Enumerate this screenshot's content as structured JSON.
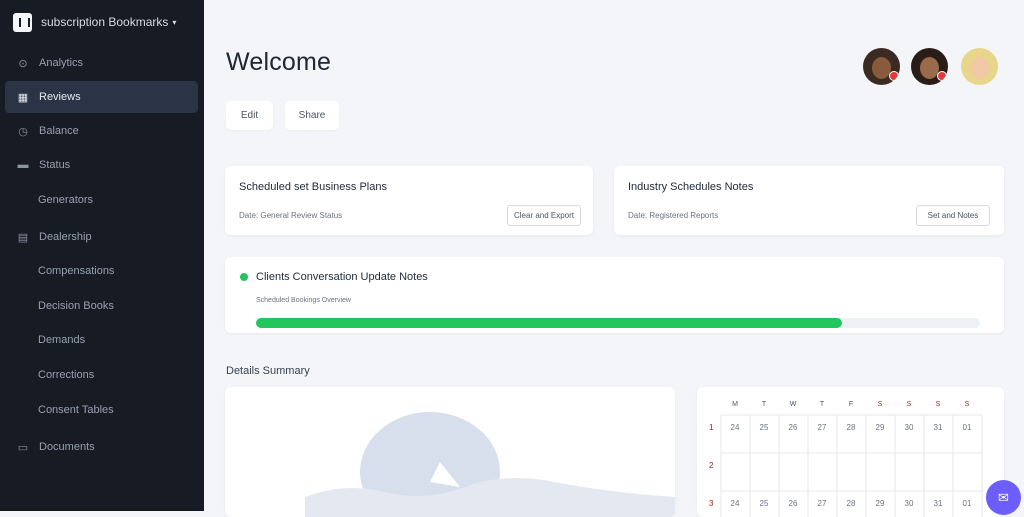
{
  "sidebar": {
    "brand_name": "subscription Bookmarks",
    "brand_caret": "▾",
    "items": [
      {
        "label": "Analytics",
        "icon": "dashboard-icon"
      },
      {
        "label": "Reviews",
        "icon": "grid-icon"
      },
      {
        "label": "Balance",
        "icon": "clock-icon"
      },
      {
        "label": "Status",
        "icon": "list-icon"
      },
      {
        "label": "Generators",
        "icon": ""
      },
      {
        "label": "Dealership",
        "icon": "calendar-icon"
      },
      {
        "label": "Compensations",
        "icon": ""
      },
      {
        "label": "Decision Books",
        "icon": ""
      },
      {
        "label": "Demands",
        "icon": ""
      },
      {
        "label": "Corrections",
        "icon": ""
      },
      {
        "label": "Consent Tables",
        "icon": ""
      },
      {
        "label": "Documents",
        "icon": "cards-icon"
      }
    ]
  },
  "main": {
    "welcome": "Welcome",
    "pills": [
      "Edit",
      "Share"
    ],
    "card1": {
      "title": "Scheduled set Business Plans",
      "sub": "Date: General Review Status",
      "button": "Clear and Export"
    },
    "card2": {
      "title": "Industry Schedules Notes",
      "sub": "Date: Registered Reports",
      "button": "Set and Notes"
    },
    "progress": {
      "title": "Clients Conversation Update Notes",
      "sub": "Scheduled Bookings Overview",
      "value": 0.81,
      "color": "#22c55e"
    },
    "section_title": "Details Summary",
    "calendar": {
      "headers": [
        "M",
        "T",
        "W",
        "T",
        "F",
        "S",
        "S",
        "S",
        "S"
      ],
      "rows": [
        {
          "label": "1",
          "cells": [
            "24",
            "25",
            "26",
            "27",
            "28",
            "29",
            "30",
            "31",
            "01"
          ]
        },
        {
          "label": "2",
          "cells": [
            "",
            "",
            "",
            "",
            "",
            "",
            "",
            "",
            ""
          ]
        },
        {
          "label": "3",
          "cells": [
            "24",
            "25",
            "26",
            "27",
            "28",
            "29",
            "30",
            "31",
            "01"
          ]
        }
      ]
    }
  },
  "fab_icon": "chat-icon",
  "colors": {
    "accent": "#22c55e",
    "sidebar_bg": "#161b24",
    "sidebar_active": "#2a3446",
    "fab": "#6d5dfc"
  }
}
